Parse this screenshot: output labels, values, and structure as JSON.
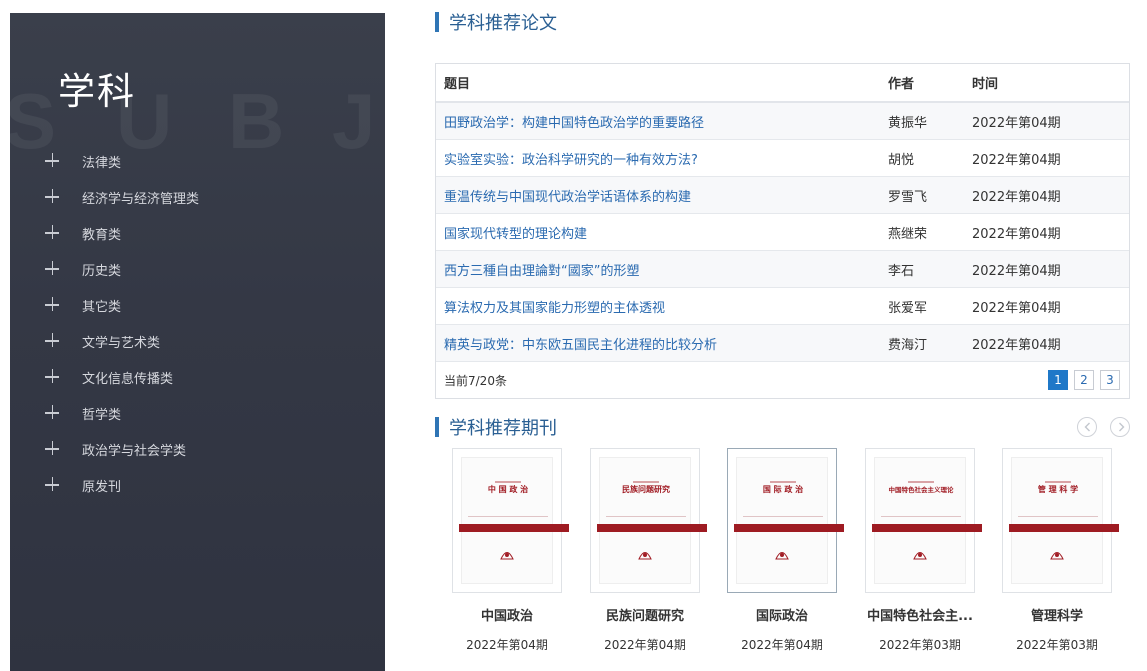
{
  "sidebar": {
    "title": "学科",
    "bg_letters": [
      "S",
      "U",
      "B",
      "J"
    ],
    "categories": [
      {
        "label": "法律类"
      },
      {
        "label": "经济学与经济管理类"
      },
      {
        "label": "教育类"
      },
      {
        "label": "历史类"
      },
      {
        "label": "其它类"
      },
      {
        "label": "文学与艺术类"
      },
      {
        "label": "文化信息传播类"
      },
      {
        "label": "哲学类"
      },
      {
        "label": "政治学与社会学类"
      },
      {
        "label": "原发刊"
      }
    ]
  },
  "papers": {
    "section_title": "学科推荐论文",
    "headers": {
      "title": "题目",
      "author": "作者",
      "date": "时间"
    },
    "rows": [
      {
        "title": "田野政治学：构建中国特色政治学的重要路径",
        "author": "黄振华",
        "date": "2022年第04期"
      },
      {
        "title": "实验室实验：政治科学研究的一种有效方法?",
        "author": "胡悦",
        "date": "2022年第04期"
      },
      {
        "title": "重温传统与中国现代政治学话语体系的构建",
        "author": "罗雪飞",
        "date": "2022年第04期"
      },
      {
        "title": "国家现代转型的理论构建",
        "author": "燕继荣",
        "date": "2022年第04期"
      },
      {
        "title": "西方三種自由理論對“國家”的形塑",
        "author": "李石",
        "date": "2022年第04期"
      },
      {
        "title": "算法权力及其国家能力形塑的主体透视",
        "author": "张爱军",
        "date": "2022年第04期"
      },
      {
        "title": "精英与政党：中东欧五国民主化进程的比较分析",
        "author": "费海汀",
        "date": "2022年第04期"
      }
    ],
    "footer_text": "当前7/20条",
    "pages": [
      "1",
      "2",
      "3"
    ],
    "active_page": "1"
  },
  "journals": {
    "section_title": "学科推荐期刊",
    "items": [
      {
        "name": "中国政治",
        "cover_title": "中 国 政 治",
        "issue": "2022年第04期"
      },
      {
        "name": "民族问题研究",
        "cover_title": "民族问题研究",
        "issue": "2022年第04期"
      },
      {
        "name": "国际政治",
        "cover_title": "国 际 政 治",
        "issue": "2022年第04期"
      },
      {
        "name": "中国特色社会主...",
        "cover_title": "中国特色社会主义理论",
        "issue": "2022年第03期"
      },
      {
        "name": "管理科学",
        "cover_title": "管 理 科 学",
        "issue": "2022年第03期"
      }
    ]
  },
  "colors": {
    "sidebar_bg": "#343845",
    "accent": "#2f75b5",
    "link": "#2a6ab0",
    "cover_red": "#9e1b22"
  }
}
